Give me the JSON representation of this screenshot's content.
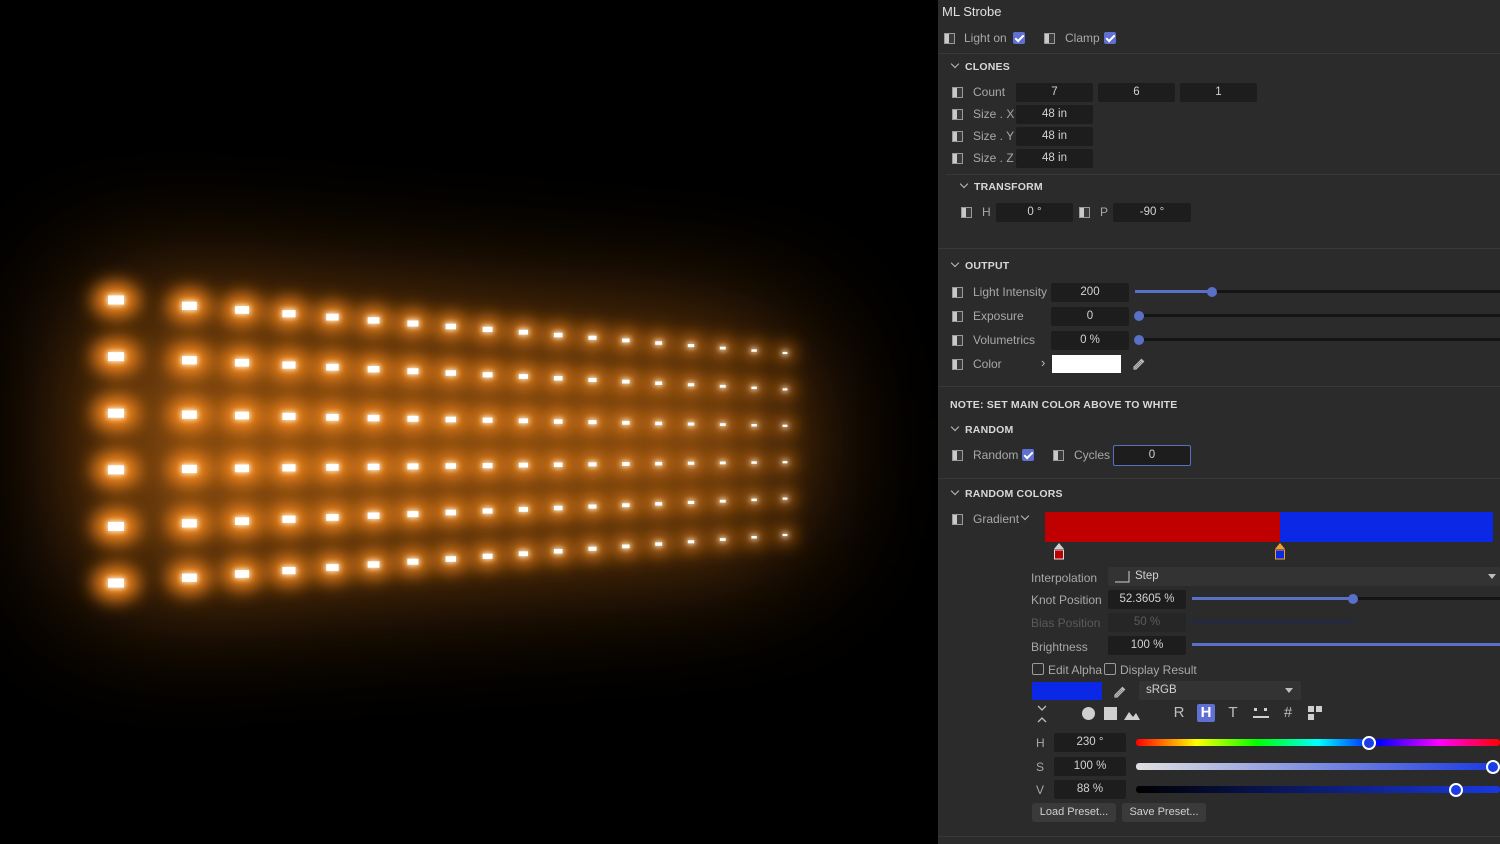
{
  "viewport": {
    "light_color": "#ff8c1a",
    "bulb_color": "#fff6d8",
    "grid_columns": 18,
    "grid_rows": 6
  },
  "panel": {
    "title": "ML Strobe",
    "light_on_label": "Light on",
    "light_on_checked": true,
    "clamp_label": "Clamp",
    "clamp_checked": true,
    "clones": {
      "header": "CLONES",
      "count_label": "Count",
      "count_values": [
        "7",
        "6",
        "1"
      ],
      "size_x_label": "Size . X",
      "size_x": "48 in",
      "size_y_label": "Size . Y",
      "size_y": "48 in",
      "size_z_label": "Size . Z",
      "size_z": "48 in"
    },
    "transform": {
      "header": "TRANSFORM",
      "h_label": "H",
      "h_value": "0 °",
      "p_label": "P",
      "p_value": "-90 °"
    },
    "output": {
      "header": "OUTPUT",
      "intensity_label": "Light Intensity",
      "intensity_value": "200",
      "intensity_slider": 0.21,
      "exposure_label": "Exposure",
      "exposure_value": "0",
      "volumetrics_label": "Volumetrics",
      "volumetrics_value": "0 %",
      "color_label": "Color",
      "color_swatch": "#ffffff"
    },
    "note": "NOTE: SET MAIN COLOR ABOVE TO WHITE",
    "random": {
      "header": "RANDOM",
      "random_label": "Random",
      "random_checked": true,
      "cycles_label": "Cycles",
      "cycles_value": "0"
    },
    "random_colors": {
      "header": "RANDOM COLORS",
      "gradient_label": "Gradient",
      "gradient_left_color": "#c00000",
      "gradient_right_color": "#0a28e6",
      "knot_position_fraction": 0.524,
      "interpolation_label": "Interpolation",
      "interpolation_value": "Step",
      "knot_position_label": "Knot Position",
      "knot_position_value": "52.3605 %",
      "bias_label": "Bias Position",
      "bias_value": "50 %",
      "brightness_label": "Brightness",
      "brightness_value": "100 %",
      "edit_alpha_label": "Edit Alpha",
      "display_result_label": "Display Result",
      "picker_swatch": "#0a28e6",
      "color_space": "sRGB",
      "mode_buttons": [
        "R",
        "H",
        "T",
        "#"
      ],
      "hsv": {
        "h_label": "H",
        "h_value": "230 °",
        "h_fraction": 0.64,
        "s_label": "S",
        "s_value": "100 %",
        "s_fraction": 1.0,
        "v_label": "V",
        "v_value": "88 %",
        "v_fraction": 0.88
      },
      "load_preset": "Load Preset...",
      "save_preset": "Save Preset..."
    }
  }
}
